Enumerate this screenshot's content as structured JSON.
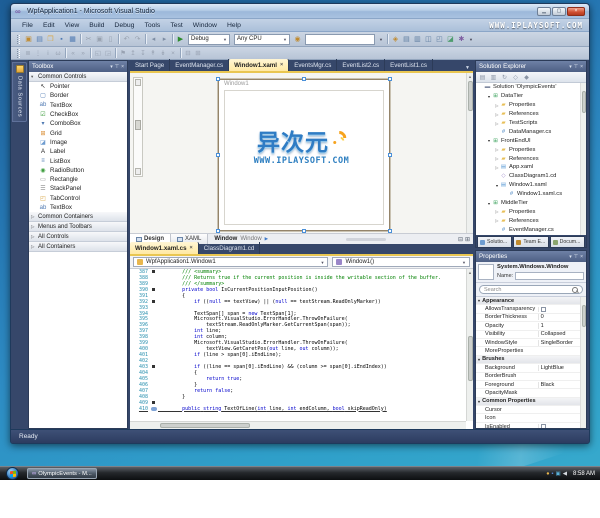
{
  "window": {
    "title": "WpfApplication1 - Microsoft Visual Studio"
  },
  "menubar": {
    "items": [
      "File",
      "Edit",
      "View",
      "Build",
      "Debug",
      "Tools",
      "Test",
      "Window",
      "Help"
    ],
    "watermark": "WWW.IPLAYSOFT.COM"
  },
  "toolbar": {
    "row1": [
      "new-project",
      "add-new-item",
      "open-file",
      "save",
      "save-all",
      "|",
      "cut",
      "copy",
      "paste",
      "|",
      "undo",
      "redo",
      "|",
      "navigate-backward",
      "navigate-forward",
      "|",
      "start-debugging",
      "combo:Debug",
      "combo:Any CPU",
      "find-symbol",
      "input:",
      "dd",
      "|",
      "find-in-files",
      "properties-window",
      "solution-explorer",
      "object-browser",
      "toolbox-window",
      "start-page",
      "extension-manager",
      "dd"
    ],
    "debug_config": "Debug",
    "platform": "Any CPU",
    "find_value": "",
    "row2": [
      "member-list",
      "parameter-info",
      "quick-info",
      "word-completion",
      "|",
      "decrease-indent",
      "increase-indent",
      "|",
      "comment-selection",
      "uncomment-selection",
      "|",
      "toggle-bookmark",
      "previous-bookmark",
      "next-bookmark",
      "previous-bookmark-folder",
      "next-bookmark-folder",
      "clear-bookmarks",
      "|",
      "toggle-outlining",
      "collapse-outlining"
    ]
  },
  "data_sources_tab": "Data Sources",
  "toolbox": {
    "title": "Toolbox",
    "sections": [
      {
        "label": "Common Controls",
        "expanded": true,
        "items": [
          {
            "icon": "pointer",
            "label": "Pointer"
          },
          {
            "icon": "border",
            "label": "Border"
          },
          {
            "icon": "textbox",
            "label": "TextBox"
          },
          {
            "icon": "checkbox",
            "label": "CheckBox"
          },
          {
            "icon": "combobox",
            "label": "ComboBox"
          },
          {
            "icon": "grid",
            "label": "Grid"
          },
          {
            "icon": "image",
            "label": "Image"
          },
          {
            "icon": "label",
            "label": "Label"
          },
          {
            "icon": "listbox",
            "label": "ListBox"
          },
          {
            "icon": "radiobutton",
            "label": "RadioButton"
          },
          {
            "icon": "rectangle",
            "label": "Rectangle"
          },
          {
            "icon": "stackpanel",
            "label": "StackPanel"
          },
          {
            "icon": "tabcontrol",
            "label": "TabControl"
          },
          {
            "icon": "textbox",
            "label": "TextBox"
          }
        ]
      },
      {
        "label": "Common Containers",
        "expanded": false,
        "items": []
      },
      {
        "label": "Menus and Toolbars",
        "expanded": false,
        "items": []
      },
      {
        "label": "All Controls",
        "expanded": false,
        "items": []
      },
      {
        "label": "All Containers",
        "expanded": false,
        "items": []
      }
    ]
  },
  "doc_tabs": [
    {
      "label": "Start Page",
      "active": false,
      "close": false
    },
    {
      "label": "EventManager.cs",
      "active": false,
      "close": false
    },
    {
      "label": "Window1.xaml",
      "active": true,
      "close": true
    },
    {
      "label": "EventsMgr.cs",
      "active": false,
      "close": false
    },
    {
      "label": "EventList2.cs",
      "active": false,
      "close": false
    },
    {
      "label": "EventList1.cs",
      "active": false,
      "close": false
    }
  ],
  "designer": {
    "window_title": "Window1",
    "design_tab": "Design",
    "xaml_tab": "XAML",
    "breadcrumb_primary": "Window",
    "breadcrumb_secondary": "Window"
  },
  "watermark_logo": {
    "cjk": "异次元",
    "site": "WWW.IPLAYSOFT.COM"
  },
  "code_tabs": [
    {
      "label": "Window1.xaml.cs",
      "active": true,
      "close": true
    },
    {
      "label": "ClassDiagram1.cd",
      "active": false,
      "close": false
    }
  ],
  "code": {
    "class_combo": "WpfApplication1.Window1",
    "method_combo": "Window1()",
    "lines": [
      {
        "n": 387,
        "mark": true,
        "segs": [
          [
            "c",
            "        /// <summary>"
          ]
        ]
      },
      {
        "n": 388,
        "segs": [
          [
            "c",
            "        /// Returns true if the current position is inside the writable section of the buffer."
          ]
        ]
      },
      {
        "n": 389,
        "segs": [
          [
            "c",
            "        /// </summary>"
          ]
        ]
      },
      {
        "n": 390,
        "mark": true,
        "segs": [
          [
            "p",
            "        "
          ],
          [
            "k",
            "private"
          ],
          [
            "p",
            " "
          ],
          [
            "k",
            "bool"
          ],
          [
            "p",
            " IsCurrentPositionInputPosition()"
          ]
        ]
      },
      {
        "n": 391,
        "segs": [
          [
            "p",
            "        {"
          ]
        ]
      },
      {
        "n": 392,
        "mark": true,
        "segs": [
          [
            "p",
            "            "
          ],
          [
            "k",
            "if"
          ],
          [
            "p",
            " (("
          ],
          [
            "k",
            "null"
          ],
          [
            "p",
            " == textView) || ("
          ],
          [
            "k",
            "null"
          ],
          [
            "p",
            " == textStream.ReadOnlyMarker))"
          ]
        ]
      },
      {
        "n": 393,
        "segs": []
      },
      {
        "n": 394,
        "segs": [
          [
            "p",
            "            TextSpan[] span = "
          ],
          [
            "k",
            "new"
          ],
          [
            "p",
            " TextSpan[1];"
          ]
        ]
      },
      {
        "n": 395,
        "segs": [
          [
            "p",
            "            Microsoft.VisualStudio.ErrorHandler.ThrowOnFailure("
          ]
        ]
      },
      {
        "n": 396,
        "segs": [
          [
            "p",
            "                textStream.ReadOnlyMarker.GetCurrentSpan(span));"
          ]
        ]
      },
      {
        "n": 397,
        "segs": [
          [
            "p",
            "            "
          ],
          [
            "k",
            "int"
          ],
          [
            "p",
            " line;"
          ]
        ]
      },
      {
        "n": 398,
        "segs": [
          [
            "p",
            "            "
          ],
          [
            "k",
            "int"
          ],
          [
            "p",
            " column;"
          ]
        ]
      },
      {
        "n": 399,
        "segs": [
          [
            "p",
            "            Microsoft.VisualStudio.ErrorHandler.ThrowOnFailure("
          ]
        ]
      },
      {
        "n": 400,
        "segs": [
          [
            "p",
            "                textView.GetCaretPos("
          ],
          [
            "k",
            "out"
          ],
          [
            "p",
            " line, "
          ],
          [
            "k",
            "out"
          ],
          [
            "p",
            " column));"
          ]
        ]
      },
      {
        "n": 401,
        "segs": [
          [
            "p",
            "            "
          ],
          [
            "k",
            "if"
          ],
          [
            "p",
            " (line > span[0].iEndLine);"
          ]
        ]
      },
      {
        "n": 402,
        "segs": []
      },
      {
        "n": 403,
        "mark": true,
        "segs": [
          [
            "p",
            "            "
          ],
          [
            "k",
            "if"
          ],
          [
            "p",
            " ((line == span[0].iEndLine) && (column >= span[0].iEndIndex))"
          ]
        ]
      },
      {
        "n": 404,
        "segs": [
          [
            "p",
            "            {"
          ]
        ]
      },
      {
        "n": 405,
        "segs": [
          [
            "p",
            "                "
          ],
          [
            "k",
            "return"
          ],
          [
            "p",
            " "
          ],
          [
            "k",
            "true"
          ],
          [
            "p",
            ";"
          ]
        ]
      },
      {
        "n": 406,
        "segs": [
          [
            "p",
            "            }"
          ]
        ]
      },
      {
        "n": 407,
        "segs": [
          [
            "p",
            "            "
          ],
          [
            "k",
            "return"
          ],
          [
            "p",
            " "
          ],
          [
            "k",
            "false"
          ],
          [
            "p",
            ";"
          ]
        ]
      },
      {
        "n": 408,
        "segs": [
          [
            "p",
            "        }"
          ]
        ]
      },
      {
        "n": 409,
        "mark": true,
        "segs": []
      },
      {
        "n": 410,
        "badge": true,
        "decl": true,
        "segs": [
          [
            "p",
            "        "
          ],
          [
            "k",
            "public"
          ],
          [
            "p",
            " "
          ],
          [
            "k",
            "string"
          ],
          [
            "p",
            " TextOfLine("
          ],
          [
            "k",
            "int"
          ],
          [
            "p",
            " line, "
          ],
          [
            "k",
            "int"
          ],
          [
            "p",
            " endColumn, "
          ],
          [
            "k",
            "bool"
          ],
          [
            "p",
            " skipReadOnly)"
          ]
        ]
      }
    ]
  },
  "solution_explorer": {
    "title": "Solution Explorer",
    "toolbar": [
      "properties",
      "show-all-files",
      "refresh",
      "view-class-diagram",
      "view-code"
    ],
    "tree": [
      {
        "label": "Solution 'OlympicEvents'",
        "icon": "solution",
        "level": 0,
        "arrow": ""
      },
      {
        "label": "DataTier",
        "icon": "project",
        "level": 1,
        "arrow": "exp"
      },
      {
        "label": "Properties",
        "icon": "folder",
        "level": 2,
        "arrow": "col"
      },
      {
        "label": "References",
        "icon": "folder",
        "level": 2,
        "arrow": "col"
      },
      {
        "label": "TestScripts",
        "icon": "folder",
        "level": 2,
        "arrow": "col"
      },
      {
        "label": "DataManager.cs",
        "icon": "cs-file",
        "level": 2,
        "arrow": ""
      },
      {
        "label": "FrontEndUI",
        "icon": "project",
        "level": 1,
        "arrow": "exp"
      },
      {
        "label": "Properties",
        "icon": "folder",
        "level": 2,
        "arrow": "col"
      },
      {
        "label": "References",
        "icon": "folder",
        "level": 2,
        "arrow": "col"
      },
      {
        "label": "App.xaml",
        "icon": "xaml-file",
        "level": 2,
        "arrow": "col"
      },
      {
        "label": "ClassDiagram1.cd",
        "icon": "cd-file",
        "level": 2,
        "arrow": ""
      },
      {
        "label": "Window1.xaml",
        "icon": "xaml-file",
        "level": 2,
        "arrow": "exp"
      },
      {
        "label": "Window1.xaml.cs",
        "icon": "cs-file",
        "level": 3,
        "arrow": ""
      },
      {
        "label": "MiddleTier",
        "icon": "project",
        "level": 1,
        "arrow": "exp"
      },
      {
        "label": "Properties",
        "icon": "folder",
        "level": 2,
        "arrow": "col"
      },
      {
        "label": "References",
        "icon": "folder",
        "level": 2,
        "arrow": "col"
      },
      {
        "label": "EventManager.cs",
        "icon": "cs-file",
        "level": 2,
        "arrow": ""
      }
    ],
    "bottom_tabs": [
      {
        "label": "Solutio...",
        "icon": "solution-explorer-tab"
      },
      {
        "label": "Team E...",
        "icon": "team-explorer-tab"
      },
      {
        "label": "Docum...",
        "icon": "document-outline-tab"
      }
    ]
  },
  "properties": {
    "title": "Properties",
    "type_name": "System.Windows.Window",
    "name_label": "Name:",
    "search_placeholder": "Search",
    "rows": [
      {
        "kind": "category",
        "label": "Appearance"
      },
      {
        "label": "AllowsTransparency",
        "checkbox": true
      },
      {
        "label": "BorderThickness",
        "value": "0"
      },
      {
        "label": "Opacity",
        "value": "1"
      },
      {
        "label": "Visibility",
        "value": "Collapsed"
      },
      {
        "label": "WindowStyle",
        "value": "SingleBorder"
      },
      {
        "label": "MoreProperties",
        "value": ""
      },
      {
        "kind": "category",
        "label": "Brushes"
      },
      {
        "label": "Background",
        "value": "LightBlue"
      },
      {
        "label": "BorderBrush",
        "value": ""
      },
      {
        "label": "Foreground",
        "value": "Black"
      },
      {
        "label": "OpacityMask",
        "value": ""
      },
      {
        "kind": "category",
        "label": "Common Properties"
      },
      {
        "label": "Cursor",
        "value": ""
      },
      {
        "label": "Icon",
        "value": ""
      },
      {
        "label": "IsEnabled",
        "checkbox": true
      }
    ]
  },
  "statusbar": {
    "text": "Ready"
  },
  "taskbar": {
    "button_label": "OlympicEvents - M...",
    "tray": [
      "update-icon",
      "messenger-icon",
      "network-icon",
      "volume-icon"
    ],
    "clock": "8:58 AM"
  },
  "colors": {
    "accent_tab": "#ffe9a4",
    "env_background": "#36476a",
    "watermark_blue": "#2f7cc4",
    "watermark_orange": "#f6a31d"
  }
}
